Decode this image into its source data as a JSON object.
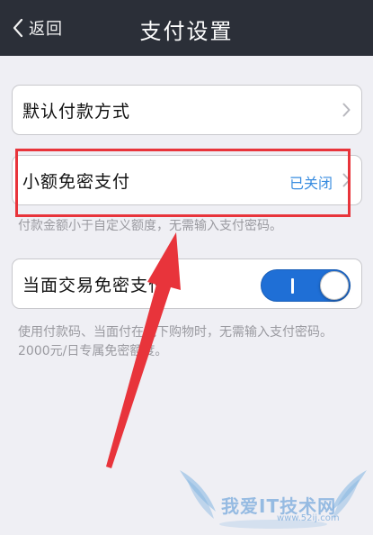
{
  "nav": {
    "back_label": "返回",
    "title": "支付设置"
  },
  "settings": {
    "default_payment": {
      "label": "默认付款方式"
    },
    "small_amount": {
      "label": "小额免密支付",
      "status": "已关闭",
      "note": "付款金额小于自定义额度，无需输入支付密码。"
    },
    "face_to_face": {
      "label": "当面交易免密支付",
      "toggle_on": true,
      "note": "使用付款码、当面付在线下购物时，无需输入支付密码。2000元/日专属免密额度。"
    }
  },
  "watermark": {
    "text": "我爱IT技术网",
    "url": "www.52ij.com"
  },
  "colors": {
    "navbar": "#2b2f38",
    "background": "#efeff4",
    "accent_blue": "#3a8de0",
    "toggle_on": "#1f6fd6",
    "annotation_red": "#e8343b"
  },
  "icons": {
    "back": "chevron-left-icon",
    "row_arrow": "chevron-right-icon"
  }
}
